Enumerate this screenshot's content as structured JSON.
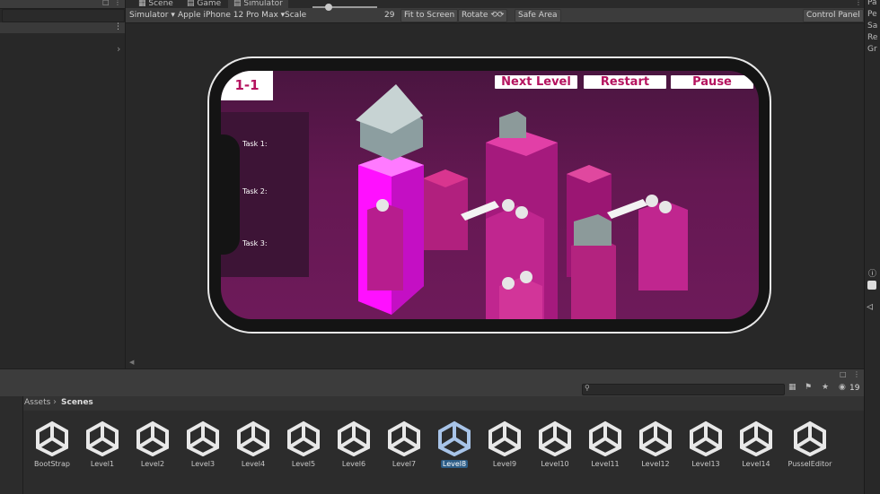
{
  "tabs": [
    {
      "label": "Scene"
    },
    {
      "label": "Game"
    },
    {
      "label": "Simulator"
    }
  ],
  "toolbar": {
    "mode_label": "Simulator",
    "device_label": "Apple iPhone 12 Pro Max",
    "scale_label": "Scale",
    "scale_value": "29",
    "fit_label": "Fit to Screen",
    "rotate_label": "Rotate",
    "safe_area_label": "Safe Area",
    "control_panel_label": "Control Panel"
  },
  "right_panel": {
    "items": [
      "Pa",
      "Pe",
      "Sa",
      "Re",
      "Gr"
    ]
  },
  "game": {
    "level_label": "1-1",
    "next_label": "Next Level",
    "restart_label": "Restart",
    "pause_label": "Pause",
    "tasks": [
      "Task 1:",
      "Task 2:",
      "Task 3:"
    ]
  },
  "project": {
    "breadcrumb_root": "Assets",
    "breadcrumb_current": "Scenes",
    "hidden_count": "19",
    "assets": [
      {
        "name": "BootStrap"
      },
      {
        "name": "Level1"
      },
      {
        "name": "Level2"
      },
      {
        "name": "Level3"
      },
      {
        "name": "Level4"
      },
      {
        "name": "Level5"
      },
      {
        "name": "Level6"
      },
      {
        "name": "Level7"
      },
      {
        "name": "Level8"
      },
      {
        "name": "Level9"
      },
      {
        "name": "Level10"
      },
      {
        "name": "Level11"
      },
      {
        "name": "Level12"
      },
      {
        "name": "Level13"
      },
      {
        "name": "Level14"
      },
      {
        "name": "PusselEditor"
      }
    ],
    "selected_asset": "Level8"
  },
  "colors": {
    "accent": "#b5135f",
    "magenta": "#ff00ff",
    "selection": "#2c5d87"
  }
}
